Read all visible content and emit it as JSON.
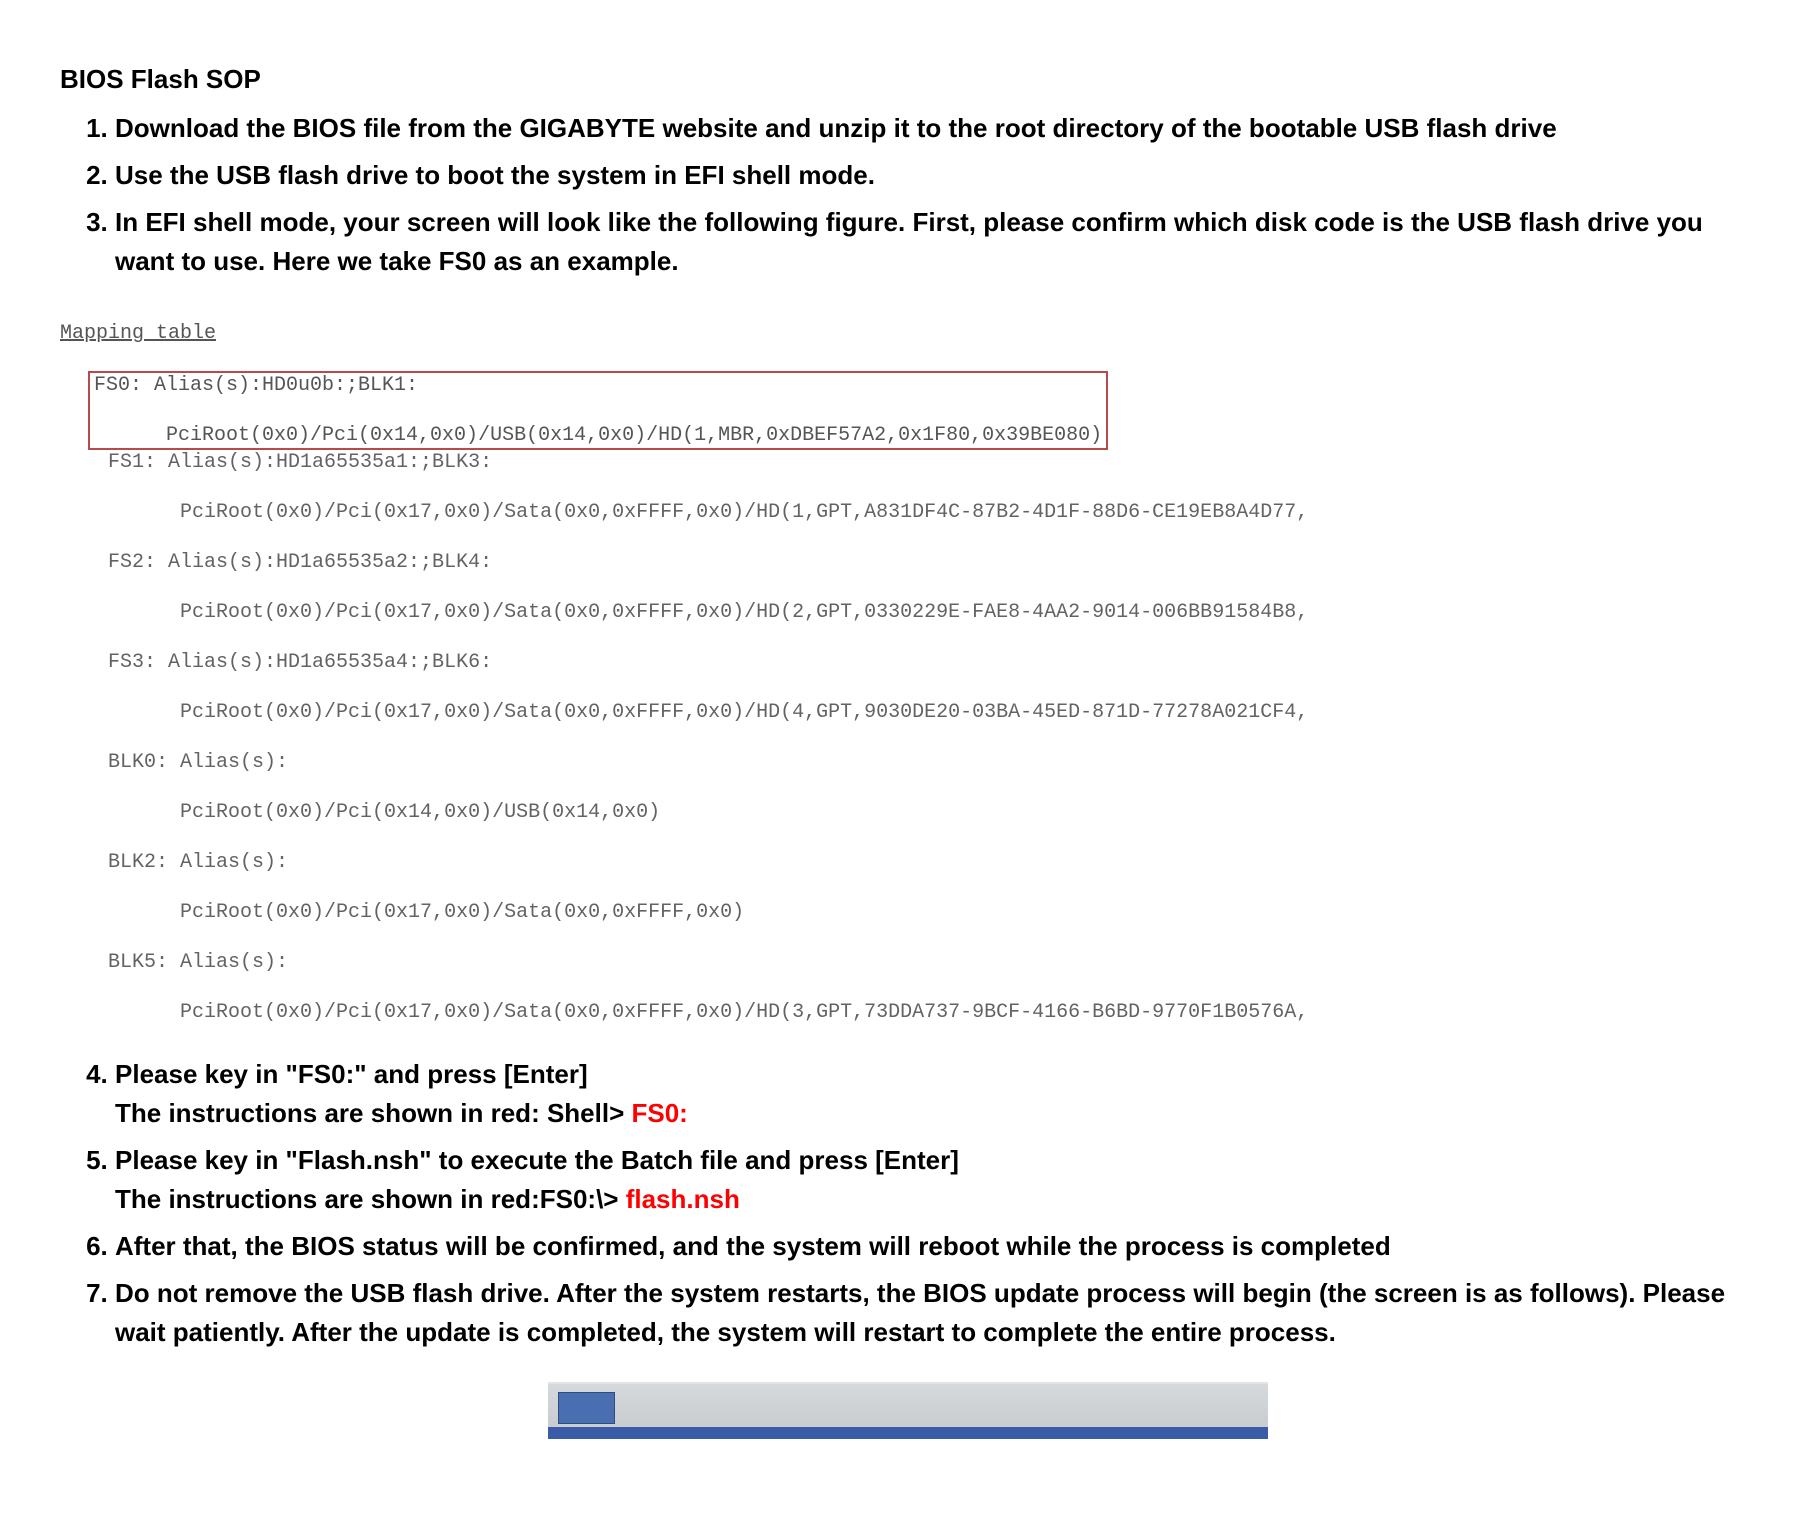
{
  "title": "BIOS Flash SOP",
  "steps": {
    "s1": "Download the BIOS file from the GIGABYTE website and unzip it to the root directory of the bootable USB flash drive",
    "s2": "Use the USB flash drive to boot the system in EFI shell mode.",
    "s3": "In EFI shell mode, your screen will look like the following figure. First, please confirm which disk code is the USB flash drive you want to use. Here we take FS0 as an example.",
    "s4a": "Please key in \"FS0:\" and press [Enter]",
    "s4b_prefix": "The instructions are shown in red: Shell> ",
    "s4b_red": "FS0:",
    "s5a": "Please key in \"Flash.nsh\" to execute the Batch file and press [Enter]",
    "s5b_prefix": "The instructions are shown in red:FS0:\\> ",
    "s5b_red": "flash.nsh",
    "s6": "After that, the BIOS status will be confirmed, and the system will reboot while the process is completed",
    "s7": "Do not remove the USB flash drive. After the system restarts, the BIOS update process will begin (the screen is as follows). Please wait patiently. After the update is completed, the system will restart to complete the entire process."
  },
  "shell": {
    "mapping": "Mapping table",
    "box": {
      "l1": "FS0: Alias(s):HD0u0b:;BLK1:",
      "l2": "      PciRoot(0x0)/Pci(0x14,0x0)/USB(0x14,0x0)/HD(1,MBR,0xDBEF57A2,0x1F80,0x39BE080)"
    },
    "l3": "    FS1: Alias(s):HD1a65535a1:;BLK3:",
    "l4": "          PciRoot(0x0)/Pci(0x17,0x0)/Sata(0x0,0xFFFF,0x0)/HD(1,GPT,A831DF4C-87B2-4D1F-88D6-CE19EB8A4D77,",
    "l5": "    FS2: Alias(s):HD1a65535a2:;BLK4:",
    "l6": "          PciRoot(0x0)/Pci(0x17,0x0)/Sata(0x0,0xFFFF,0x0)/HD(2,GPT,0330229E-FAE8-4AA2-9014-006BB91584B8,",
    "l7": "    FS3: Alias(s):HD1a65535a4:;BLK6:",
    "l8": "          PciRoot(0x0)/Pci(0x17,0x0)/Sata(0x0,0xFFFF,0x0)/HD(4,GPT,9030DE20-03BA-45ED-871D-77278A021CF4,",
    "l9": "    BLK0: Alias(s):",
    "l10": "          PciRoot(0x0)/Pci(0x14,0x0)/USB(0x14,0x0)",
    "l11": "    BLK2: Alias(s):",
    "l12": "          PciRoot(0x0)/Pci(0x17,0x0)/Sata(0x0,0xFFFF,0x0)",
    "l13": "    BLK5: Alias(s):",
    "l14": "          PciRoot(0x0)/Pci(0x17,0x0)/Sata(0x0,0xFFFF,0x0)/HD(3,GPT,73DDA737-9BCF-4166-B6BD-9770F1B0576A,"
  }
}
